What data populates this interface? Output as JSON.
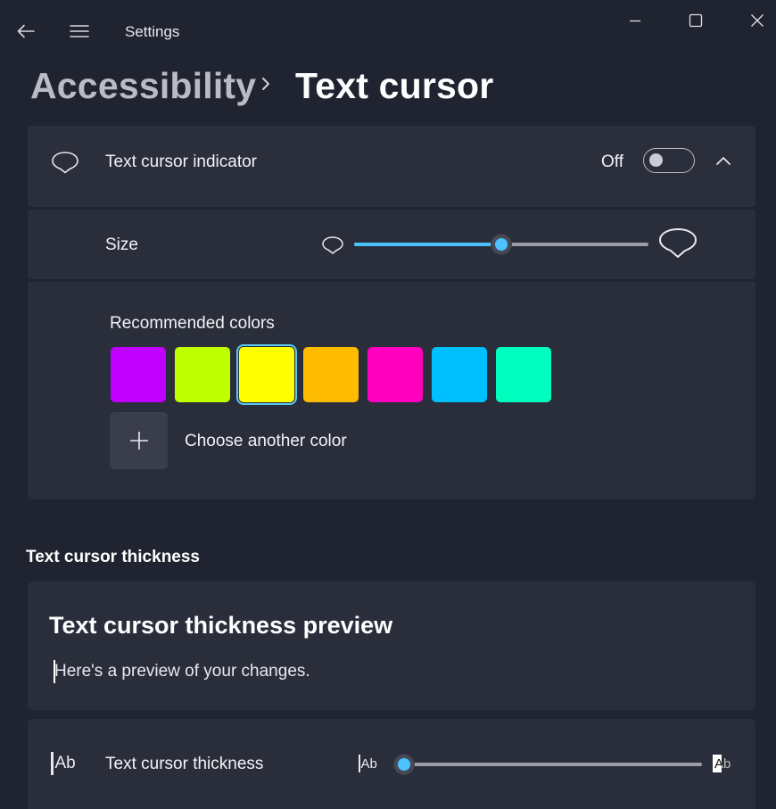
{
  "window": {
    "title": "Settings"
  },
  "breadcrumb": {
    "parent": "Accessibility",
    "current": "Text cursor"
  },
  "indicator": {
    "label": "Text cursor indicator",
    "state_label": "Off",
    "enabled": false
  },
  "size": {
    "label": "Size",
    "value_fraction": 0.5,
    "accent": "#4cc2ff"
  },
  "colors": {
    "heading": "Recommended colors",
    "swatches": [
      "#bf00ff",
      "#bfff00",
      "#ffff00",
      "#ffbb00",
      "#ff00bf",
      "#00bfff",
      "#00ffbf"
    ],
    "selected_index": 2,
    "choose_label": "Choose another color"
  },
  "thickness_section": {
    "heading": "Text cursor thickness"
  },
  "preview": {
    "title": "Text cursor thickness preview",
    "text": "Here's a preview of your changes."
  },
  "thickness": {
    "label": "Text cursor thickness",
    "icon_text": "Ab",
    "value_fraction": 0.0,
    "accent": "#4cc2ff"
  }
}
